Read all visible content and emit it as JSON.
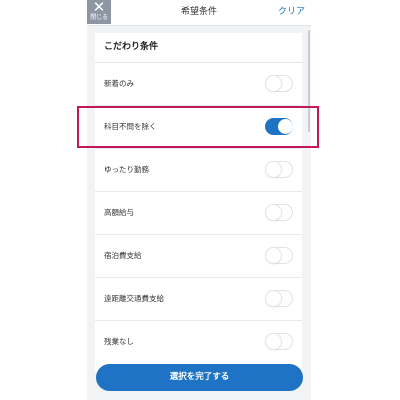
{
  "header": {
    "close_icon_glyph": "✕",
    "close_label": "閉じる",
    "title": "希望条件",
    "clear_label": "クリア"
  },
  "section": {
    "title": "こだわり条件"
  },
  "options": [
    {
      "label": "新着のみ",
      "on": false
    },
    {
      "label": "科目不問を除く",
      "on": true
    },
    {
      "label": "ゆったり勤務",
      "on": false
    },
    {
      "label": "高額給与",
      "on": false
    },
    {
      "label": "宿泊費支給",
      "on": false
    },
    {
      "label": "遠距離交通費支給",
      "on": false
    },
    {
      "label": "残業なし",
      "on": false
    }
  ],
  "footer": {
    "submit_label": "選択を完了する"
  },
  "colors": {
    "accent": "#1f73c4",
    "highlight": "#c2185b",
    "close_bg": "#8e95a3"
  }
}
